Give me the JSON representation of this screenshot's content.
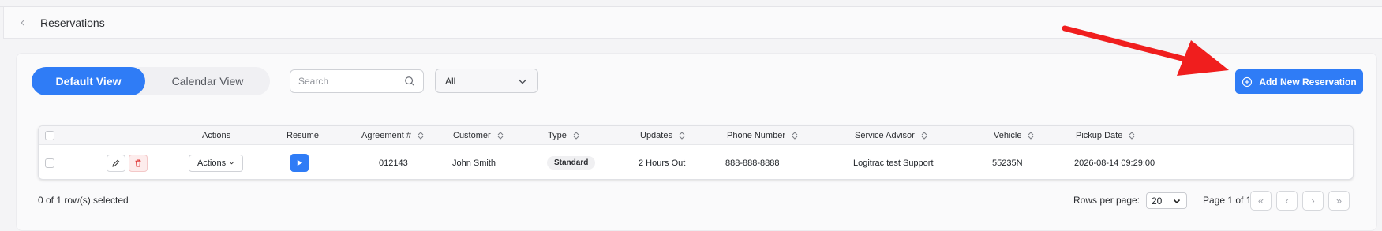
{
  "header": {
    "title": "Reservations"
  },
  "views": {
    "default_label": "Default View",
    "calendar_label": "Calendar View"
  },
  "search": {
    "placeholder": "Search"
  },
  "filter": {
    "selected": "All"
  },
  "add_button": {
    "label": "Add New Reservation"
  },
  "table": {
    "headers": {
      "actions": "Actions",
      "resume": "Resume",
      "agreement": "Agreement #",
      "customer": "Customer",
      "type": "Type",
      "updates": "Updates",
      "phone": "Phone Number",
      "advisor": "Service Advisor",
      "vehicle": "Vehicle",
      "pickup": "Pickup Date"
    },
    "rows": [
      {
        "actions_label": "Actions",
        "agreement": "012143",
        "customer": "John Smith",
        "type": "Standard",
        "updates": "2 Hours Out",
        "phone": "888-888-8888",
        "advisor": "Logitrac test Support",
        "vehicle": "55235N",
        "pickup": "2026-08-14 09:29:00"
      }
    ]
  },
  "footer": {
    "selected": "0 of 1 row(s) selected",
    "rows_per_page_label": "Rows per page:",
    "rows_per_page": "20",
    "page_info": "Page 1 of 1",
    "first": "«",
    "prev": "‹",
    "next": "›",
    "last": "»"
  },
  "colors": {
    "accent": "#2f7cf6",
    "arrow": "#f01e1e",
    "delete": "#e03a3a"
  }
}
